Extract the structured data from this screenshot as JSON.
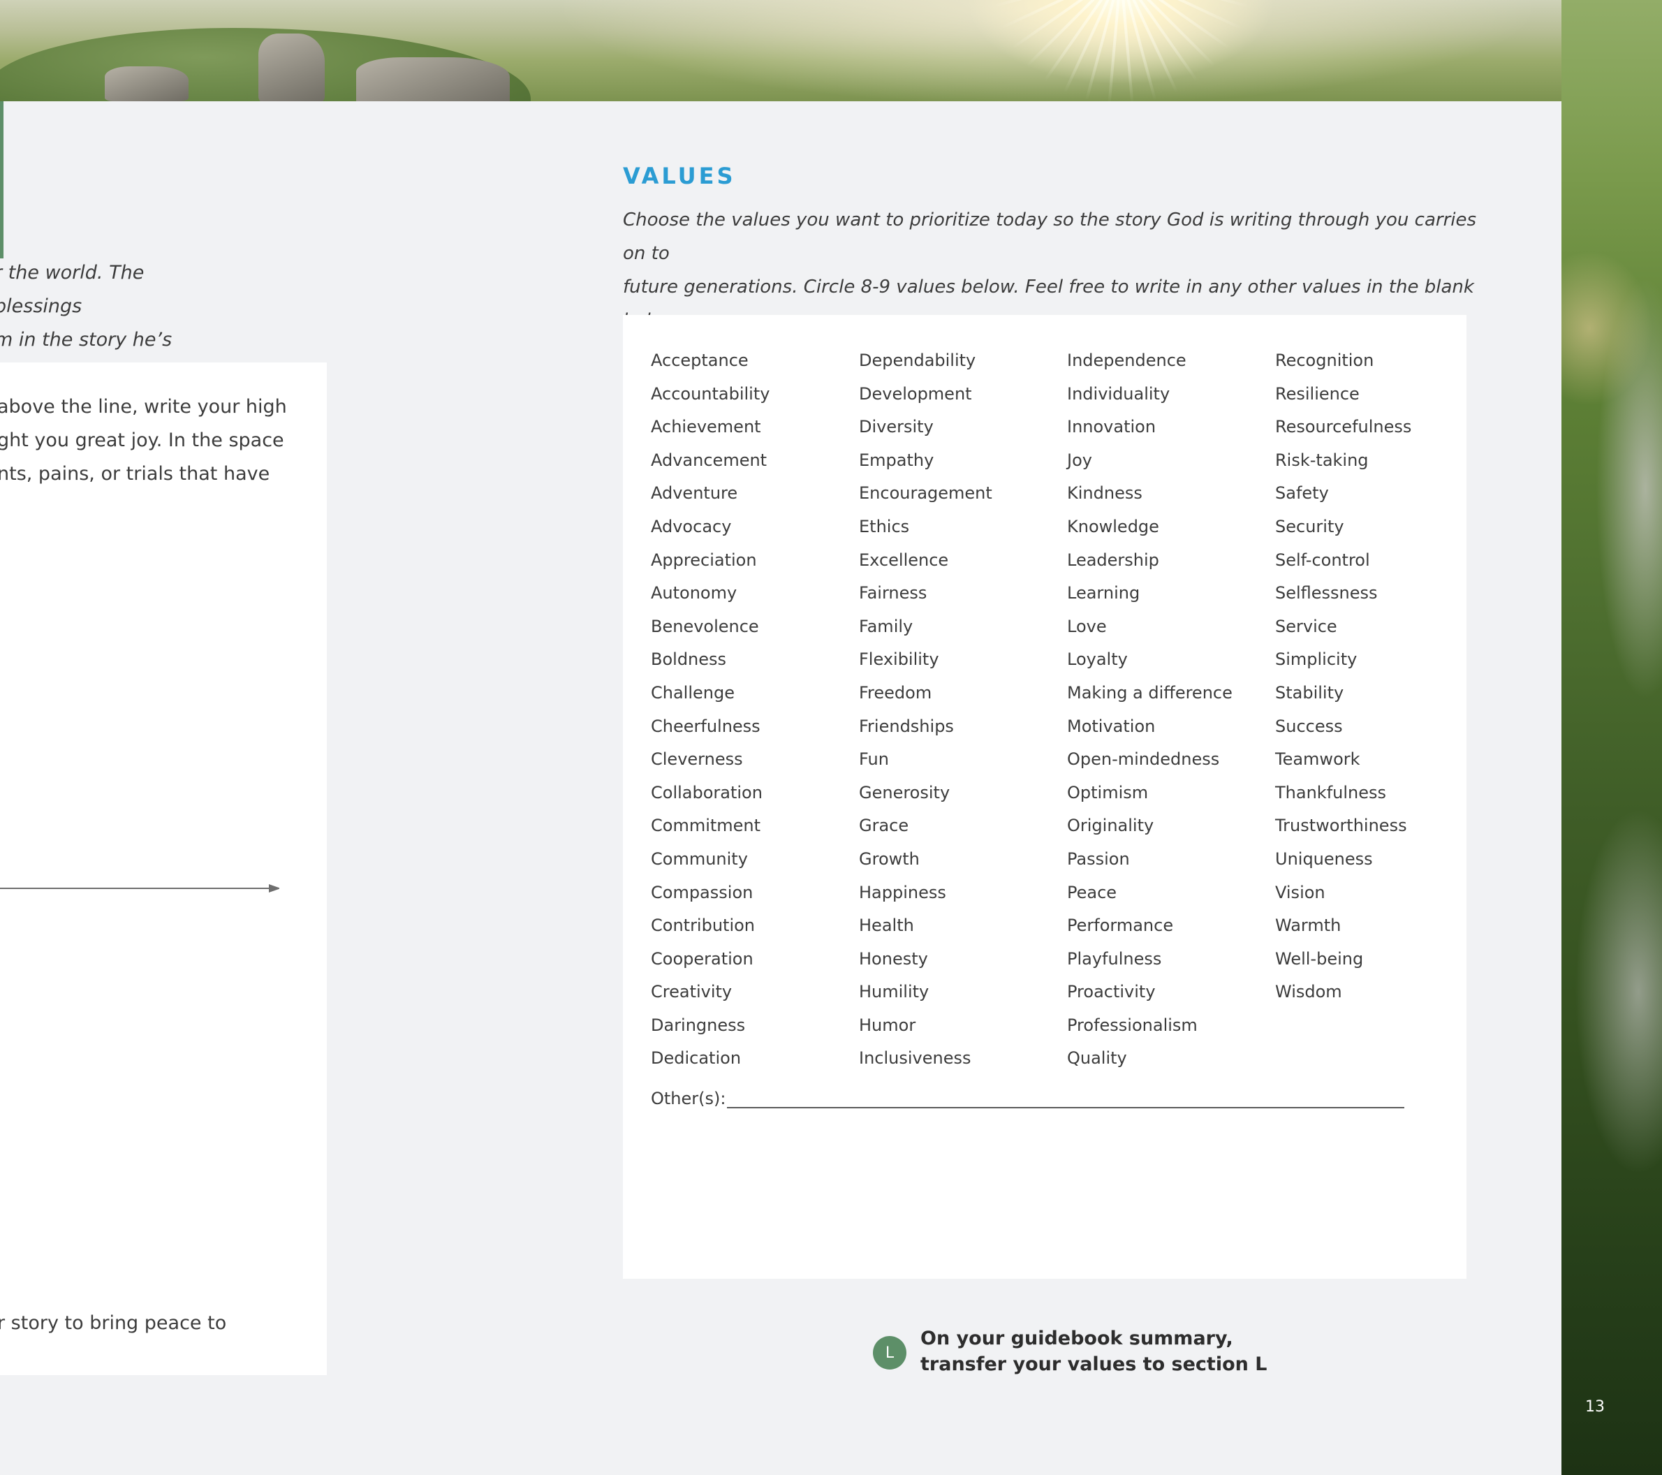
{
  "left_column": {
    "intro_lines": [
      "r the world. The blessings",
      "m in the story he’s writing."
    ],
    "box_lines": [
      "above the line, write your high",
      "ght you great joy. In the space",
      "nts, pains, or trials that have"
    ],
    "box_bottom_line": "r story to bring peace to"
  },
  "values": {
    "title": "VALUES",
    "instructions_line1": "Choose the values you want to prioritize today so the story God is writing through you carries on to",
    "instructions_line2": "future generations. Circle 8-9 values below. Feel free to write in any other values in the blank below.",
    "columns": [
      [
        "Acceptance",
        "Accountability",
        "Achievement",
        "Advancement",
        "Adventure",
        "Advocacy",
        "Appreciation",
        "Autonomy",
        "Benevolence",
        "Boldness",
        "Challenge",
        "Cheerfulness",
        "Cleverness",
        "Collaboration",
        "Commitment",
        "Community",
        "Compassion",
        "Contribution",
        "Cooperation",
        "Creativity",
        "Daringness",
        "Dedication"
      ],
      [
        "Dependability",
        "Development",
        "Diversity",
        "Empathy",
        "Encouragement",
        "Ethics",
        "Excellence",
        "Fairness",
        "Family",
        "Flexibility",
        "Freedom",
        "Friendships",
        "Fun",
        "Generosity",
        "Grace",
        "Growth",
        "Happiness",
        "Health",
        "Honesty",
        "Humility",
        "Humor",
        "Inclusiveness"
      ],
      [
        "Independence",
        "Individuality",
        "Innovation",
        "Joy",
        "Kindness",
        "Knowledge",
        "Leadership",
        "Learning",
        "Love",
        "Loyalty",
        "Making a difference",
        "Motivation",
        "Open-mindedness",
        "Optimism",
        "Originality",
        "Passion",
        "Peace",
        "Performance",
        "Playfulness",
        "Proactivity",
        "Professionalism",
        "Quality"
      ],
      [
        "Recognition",
        "Resilience",
        "Resourcefulness",
        "Risk-taking",
        "Safety",
        "Security",
        "Self-control",
        "Selflessness",
        "Service",
        "Simplicity",
        "Stability",
        "Success",
        "Teamwork",
        "Thankfulness",
        "Trustworthiness",
        "Uniqueness",
        "Vision",
        "Warmth",
        "Well-being",
        "Wisdom"
      ]
    ],
    "others_label": "Other(s):"
  },
  "callout": {
    "badge": "L",
    "line1": "On your guidebook summary,",
    "line2": "transfer your values to section L"
  },
  "page_number": "13",
  "colors": {
    "title_blue": "#2b9cd3",
    "accent_green": "#5d8f68",
    "panel_bg": "#f1f2f4"
  }
}
